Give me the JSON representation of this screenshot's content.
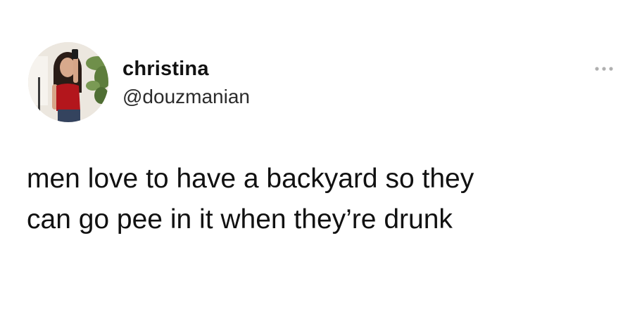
{
  "author": {
    "display_name": "christina",
    "handle": "@douzmanian",
    "avatar_icon": "profile-photo"
  },
  "more_icon": "more-options-icon",
  "tweet": {
    "text": "men love to have a backyard so they\ncan go pee in it when they’re drunk"
  },
  "colors": {
    "background": "#ffffff",
    "text": "#111111",
    "muted": "#b0b0b0"
  }
}
